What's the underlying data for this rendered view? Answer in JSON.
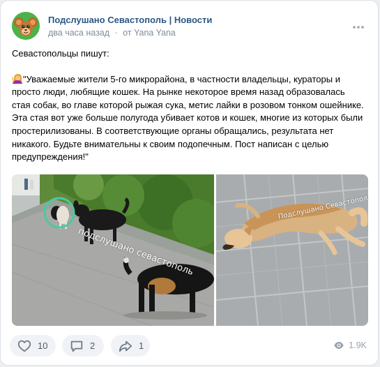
{
  "post": {
    "author": "Подслушано Севастополь | Новости",
    "time": "два часа назад",
    "separator": "·",
    "source_prefix": "от",
    "source_name": "Yana Yana",
    "intro": "Севастопольцы пишут:",
    "body": "\"Уважаемые жители 5-го микрорайона, в частности владельцы, кураторы и просто люди, любящие кошек. На рынке некоторое время назад образовалась стая собак, во главе которой рыжая сука, метис лайки в розовом тонком ошейнике. Эта стая вот уже больше полугода убивает котов и кошек, многие из которых были простерилизованы. В соответствующие органы обращались, результата нет никакого. Будьте внимательны к своим подопечным. Пост написан с целью предупреждения!\"",
    "watermark_1": "подслушано севастополь",
    "watermark_2": "Подслушано Севастополь"
  },
  "icons": {
    "more": "more-dots-icon",
    "emoji": "person-gesturing-emoji-icon",
    "like": "heart-icon",
    "comment": "comment-icon",
    "share": "share-arrow-icon",
    "views": "eye-icon"
  },
  "actions": {
    "likes": "10",
    "comments": "2",
    "shares": "1",
    "views": "1.9K"
  },
  "colors": {
    "link": "#2a5885",
    "muted": "#818c99",
    "button_bg": "#f0f2f5",
    "accent_green": "#4bb34b"
  }
}
